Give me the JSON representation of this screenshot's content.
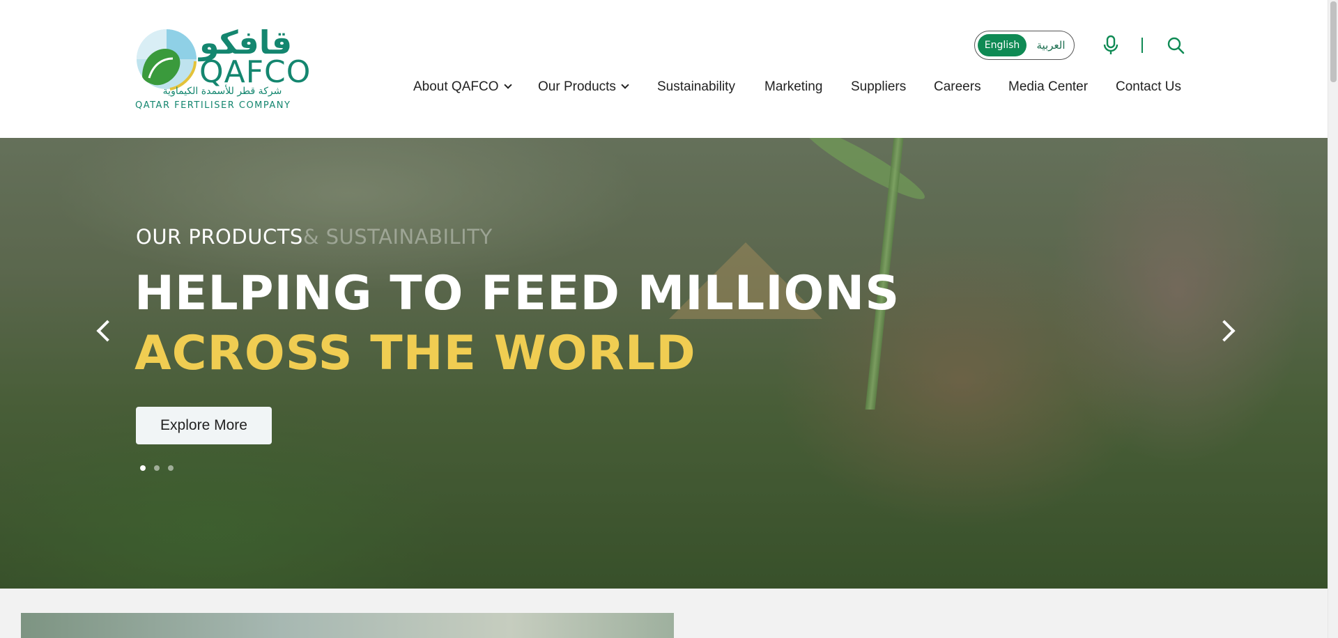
{
  "header": {
    "logo": {
      "arabic_word": "قافكو",
      "latin_word": "QAFCO",
      "arabic_subtitle": "شركة قطر للأسمدة الكيماوية",
      "latin_subtitle": "QATAR FERTILISER COMPANY"
    },
    "language": {
      "english": "English",
      "arabic": "العربية",
      "active": "English"
    },
    "icons": {
      "mic": "microphone-icon",
      "search": "search-icon"
    },
    "nav": [
      {
        "label": "About QAFCO",
        "has_dropdown": true
      },
      {
        "label": "Our Products",
        "has_dropdown": true
      },
      {
        "label": "Sustainability",
        "has_dropdown": false
      },
      {
        "label": "Marketing",
        "has_dropdown": false
      },
      {
        "label": "Suppliers",
        "has_dropdown": false
      },
      {
        "label": "Careers",
        "has_dropdown": false
      },
      {
        "label": "Media Center",
        "has_dropdown": false
      },
      {
        "label": "Contact Us",
        "has_dropdown": false
      }
    ]
  },
  "hero": {
    "subtitle": "OUR PRODUCTS",
    "subtitle_ghost": "& SUSTAINABILITY",
    "title_line1": "HELPING TO FEED MILLIONS",
    "title_line2": "ACROSS THE WORLD",
    "button": "Explore More",
    "slides_count": 3,
    "active_slide": 1
  },
  "colors": {
    "brand_green": "#0f8a54",
    "logo_teal": "#14866f",
    "accent_yellow": "#f0cd52"
  }
}
